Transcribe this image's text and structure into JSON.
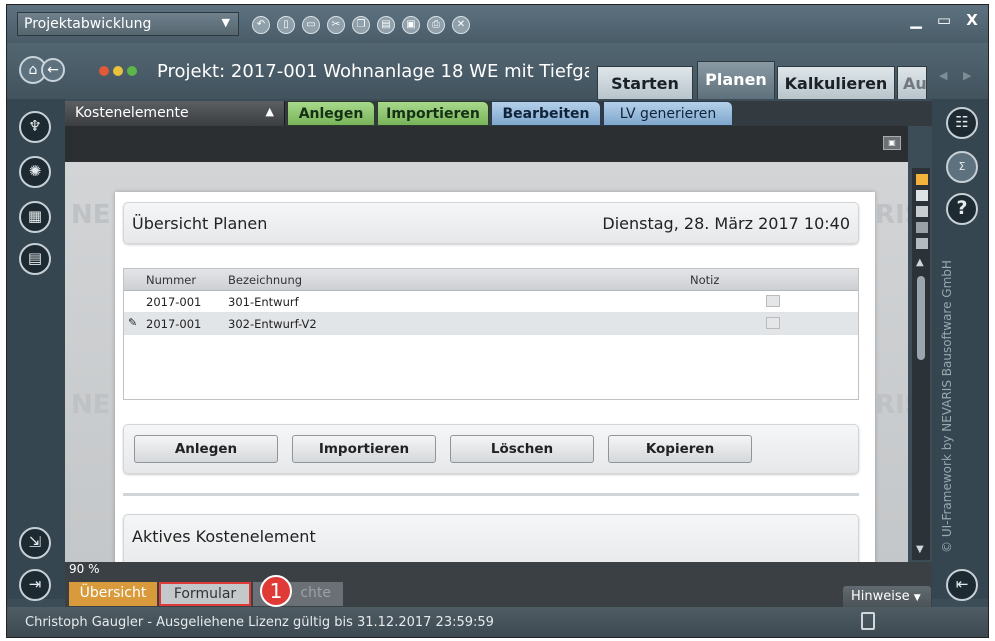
{
  "app_selector": {
    "label": "Projektabwicklung"
  },
  "window_controls": {
    "minimize": "▁",
    "maximize": "▭",
    "close": "X"
  },
  "project_title": "Projekt: 2017-001 Wohnanlage 18 WE mit Tiefga",
  "tabs": [
    {
      "label": "Starten"
    },
    {
      "label": "Planen"
    },
    {
      "label": "Kalkulieren"
    },
    {
      "label": "Au"
    }
  ],
  "ribbon": {
    "selector": "Kostenelemente",
    "buttons": [
      "Anlegen",
      "Importieren",
      "Bearbeiten",
      "LV generieren"
    ]
  },
  "panel": {
    "header_title": "Übersicht Planen",
    "datetime": "Dienstag, 28. März 2017 10:40",
    "grid": {
      "columns": [
        "Nummer",
        "Bezeichnung",
        "Notiz"
      ],
      "rows": [
        {
          "nummer": "2017-001",
          "bezeichnung": "301-Entwurf"
        },
        {
          "nummer": "2017-001",
          "bezeichnung": "302-Entwurf-V2"
        }
      ]
    },
    "actions": [
      "Anlegen",
      "Importieren",
      "Löschen",
      "Kopieren"
    ],
    "section2_title": "Aktives Kostenelement"
  },
  "watermark": {
    "left": "NE",
    "right": "RIS",
    "side_text": "© UI-Framework by NEVARIS Bausoftware GmbH"
  },
  "zoom": "90 %",
  "bottom_tabs": [
    "Übersicht",
    "Formular",
    "chte"
  ],
  "callout": "1",
  "hinweise": "Hinweise",
  "status_text": "Christoph Gaugler - Ausgeliehene Lizenz gültig bis 31.12.2017 23:59:59",
  "colors": {
    "accent_green": "#8dc06e",
    "accent_blue": "#8fb4d6",
    "tab_orange": "#d99a3c",
    "callout_red": "#e03a36"
  }
}
